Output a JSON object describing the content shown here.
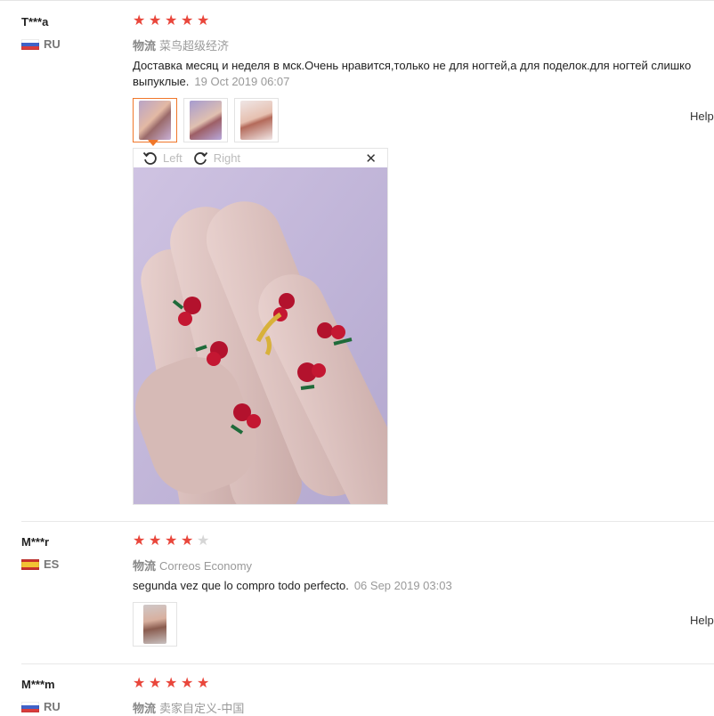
{
  "reviews": [
    {
      "user": "T***a",
      "country": "RU",
      "rating": 5,
      "logistics_label": "物流",
      "logistics_value": "菜鸟超级经济",
      "text_line1": "Доставка месяц и неделя в мск.Очень нравится,только не для ногтей,а для поделок.для ногтей слишко",
      "text_line2": "выпуклые.",
      "date": "19 Oct 2019 06:07",
      "helpful": "Help"
    },
    {
      "user": "M***r",
      "country": "ES",
      "rating": 4,
      "logistics_label": "物流",
      "logistics_value": "Correos Economy",
      "text_line1": "segunda vez que lo compro todo perfecto.",
      "date": "06 Sep 2019 03:03",
      "helpful": "Help"
    },
    {
      "user": "M***m",
      "country": "RU",
      "rating": 5,
      "logistics_label": "物流",
      "logistics_value": "卖家自定义-中国"
    }
  ],
  "viewer": {
    "rotate_left": "Left",
    "rotate_right": "Right",
    "close": "✕"
  },
  "icons": {
    "star": "★",
    "rotate_left": "rotate-left-icon",
    "rotate_right": "rotate-right-icon"
  },
  "colors": {
    "star_on": "#e9463b",
    "star_off": "#d6d6d6",
    "active_thumb": "#f0772a"
  }
}
